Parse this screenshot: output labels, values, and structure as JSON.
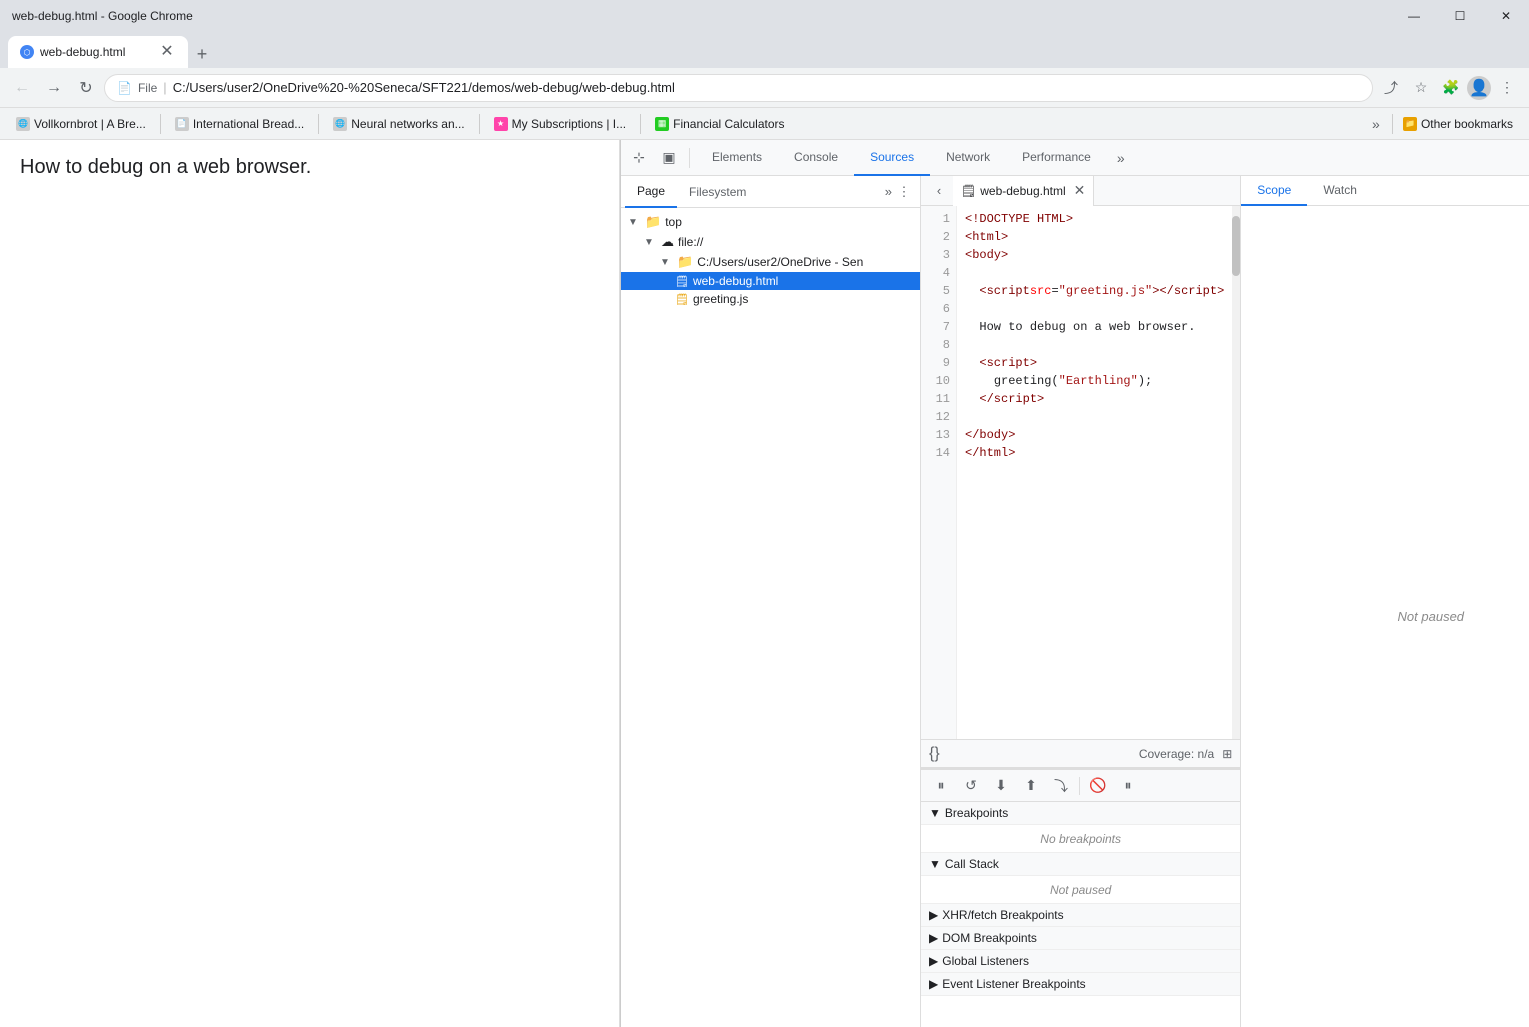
{
  "window": {
    "title": "web-debug.html - Google Chrome",
    "min_label": "—",
    "max_label": "☐",
    "close_label": "✕"
  },
  "tab": {
    "title": "web-debug.html",
    "close": "✕",
    "new_tab": "+"
  },
  "address_bar": {
    "url": "C:/Users/user2/OneDrive%20-%20Seneca/SFT221/demos/web-debug/web-debug.html",
    "file_label": "File",
    "separator": "|"
  },
  "bookmarks": [
    {
      "id": "bm1",
      "label": "Vollkornbrot | A Bre...",
      "icon": "🌐"
    },
    {
      "id": "bm2",
      "label": "International Bread...",
      "icon": "📄"
    },
    {
      "id": "bm3",
      "label": "Neural networks an...",
      "icon": "🌐"
    },
    {
      "id": "bm4",
      "label": "My Subscriptions | I...",
      "icon": "⭐"
    },
    {
      "id": "bm5",
      "label": "Financial Calculators",
      "icon": "📊"
    },
    {
      "id": "bm6",
      "label": "Other bookmarks",
      "icon": "📁"
    }
  ],
  "page": {
    "heading": "How to debug on a web browser."
  },
  "devtools": {
    "tabs": [
      {
        "id": "elements",
        "label": "Elements"
      },
      {
        "id": "console",
        "label": "Console"
      },
      {
        "id": "sources",
        "label": "Sources",
        "active": true
      },
      {
        "id": "network",
        "label": "Network"
      },
      {
        "id": "performance",
        "label": "Performance"
      }
    ]
  },
  "sources_left_tabs": [
    {
      "id": "page",
      "label": "Page",
      "active": true
    },
    {
      "id": "filesystem",
      "label": "Filesystem"
    }
  ],
  "file_tree": {
    "items": [
      {
        "id": "top",
        "label": "top",
        "type": "folder",
        "depth": 0,
        "arrow": "▶",
        "expanded": true
      },
      {
        "id": "file",
        "label": "file://",
        "type": "folder-cloud",
        "depth": 1,
        "arrow": "▶",
        "expanded": true
      },
      {
        "id": "dir",
        "label": "C:/Users/user2/OneDrive - Sen",
        "type": "folder",
        "depth": 2,
        "arrow": "▶",
        "expanded": true
      },
      {
        "id": "webdebug",
        "label": "web-debug.html",
        "type": "file-html",
        "depth": 3,
        "selected": true
      },
      {
        "id": "greetingjs",
        "label": "greeting.js",
        "type": "file-js",
        "depth": 3
      }
    ]
  },
  "editor": {
    "file_tab": "web-debug.html",
    "lines": [
      {
        "num": 1,
        "content": "<!DOCTYPE HTML>"
      },
      {
        "num": 2,
        "content": "<html>"
      },
      {
        "num": 3,
        "content": "<body>"
      },
      {
        "num": 4,
        "content": ""
      },
      {
        "num": 5,
        "content": "  <script src=\"greeting.js\"></script>"
      },
      {
        "num": 6,
        "content": ""
      },
      {
        "num": 7,
        "content": "  How to debug on a web browser."
      },
      {
        "num": 8,
        "content": ""
      },
      {
        "num": 9,
        "content": "  <script>"
      },
      {
        "num": 10,
        "content": "    greeting(\"Earthling\");"
      },
      {
        "num": 11,
        "content": "  </script>"
      },
      {
        "num": 12,
        "content": ""
      },
      {
        "num": 13,
        "content": "</body>"
      },
      {
        "num": 14,
        "content": "</html>"
      }
    ],
    "coverage_label": "Coverage: n/a"
  },
  "debug_toolbar": {
    "buttons": [
      "⏸",
      "↺",
      "⬇",
      "⬆",
      "⤵",
      "🚫",
      "⏸"
    ]
  },
  "breakpoints": {
    "header": "Breakpoints",
    "empty_label": "No breakpoints"
  },
  "call_stack": {
    "header": "Call Stack",
    "empty_label": "Not paused"
  },
  "xhr_breakpoints": {
    "header": "XHR/fetch Breakpoints"
  },
  "dom_breakpoints": {
    "header": "DOM Breakpoints"
  },
  "global_listeners": {
    "header": "Global Listeners"
  },
  "event_listener_breakpoints": {
    "header": "Event Listener Breakpoints"
  },
  "scope_tabs": [
    {
      "id": "scope",
      "label": "Scope",
      "active": true
    },
    {
      "id": "watch",
      "label": "Watch"
    }
  ],
  "scope": {
    "not_paused": "Not paused"
  }
}
